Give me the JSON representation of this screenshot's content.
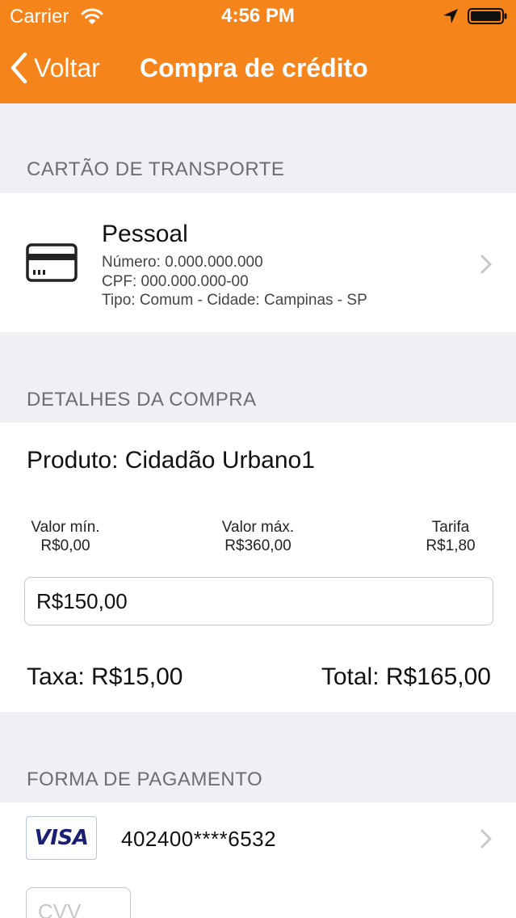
{
  "status_bar": {
    "carrier": "Carrier",
    "time": "4:56 PM",
    "icons": [
      "wifi-icon",
      "location-arrow-icon",
      "battery-icon"
    ]
  },
  "nav": {
    "back_label": "Voltar",
    "title": "Compra de crédito"
  },
  "transport_card": {
    "section_title": "CARTÃO DE TRANSPORTE",
    "icon": "credit-card-icon",
    "name": "Pessoal",
    "numero": "Número: 0.000.000.000",
    "cpf": "CPF: 000.000.000-00",
    "tipo": "Tipo: Comum - Cidade: Campinas - SP"
  },
  "purchase": {
    "section_title": "DETALHES DA COMPRA",
    "product": "Produto: Cidadão Urbano1",
    "min_label": "Valor mín.",
    "min_value": "R$0,00",
    "max_label": "Valor máx.",
    "max_value": "R$360,00",
    "tarifa_label": "Tarifa",
    "tarifa_value": "R$1,80",
    "amount_value": "R$150,00",
    "taxa": "Taxa: R$15,00",
    "total": "Total: R$165,00"
  },
  "payment": {
    "section_title": "FORMA DE PAGAMENTO",
    "card_brand": "VISA",
    "card_number": "402400****6532",
    "cvv_placeholder": "CVV"
  },
  "colors": {
    "accent": "#f5841b",
    "background": "#efeff4",
    "section_text": "#6d6d72",
    "visa_blue": "#1a1f71"
  }
}
